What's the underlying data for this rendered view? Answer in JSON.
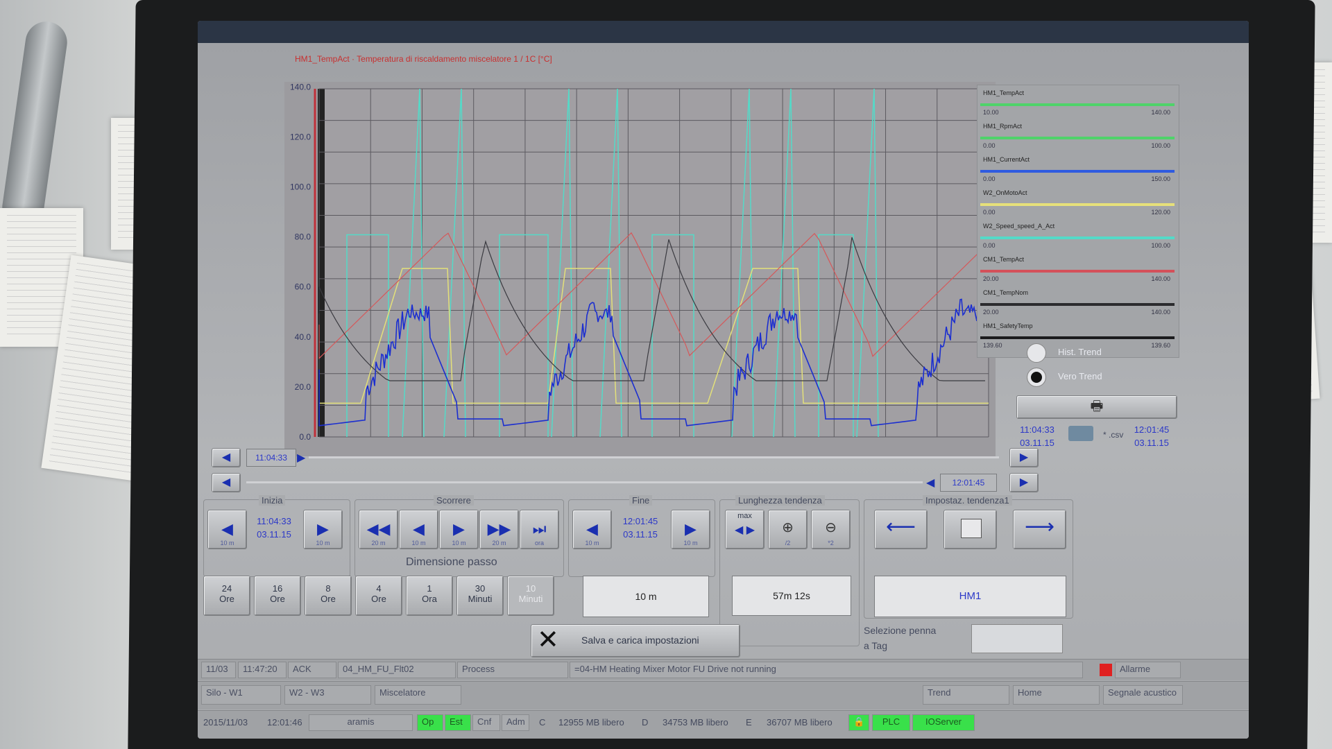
{
  "plot": {
    "title": "HM1_TempAct · Temperatura di riscaldamento miscelatore 1 / 1C [°C]",
    "y_ticks": [
      "0.0",
      "20.0",
      "40.0",
      "60.0",
      "80.0",
      "100.0",
      "120.0",
      "140.0"
    ],
    "colors": {
      "blue": "#1b2ed0",
      "yellow": "#e3e07a",
      "cyan": "#54dac8",
      "red": "#d5585a",
      "dark": "#3a3a40"
    }
  },
  "legend": {
    "items": [
      {
        "tag": "HM1_TempAct",
        "color": "#4fd36a",
        "min": "10.00",
        "max": "140.00"
      },
      {
        "tag": "HM1_RpmAct",
        "color": "#4fd36a",
        "min": "0.00",
        "max": "100.00"
      },
      {
        "tag": "HM1_CurrentAct",
        "color": "#2f5be0",
        "min": "0.00",
        "max": "150.00"
      },
      {
        "tag": "W2_OnMotoAct",
        "color": "#e6e07a",
        "min": "0.00",
        "max": "120.00"
      },
      {
        "tag": "W2_Speed_speed_A_Act",
        "color": "#54dac8",
        "min": "0.00",
        "max": "100.00"
      },
      {
        "tag": "CM1_TempAct",
        "color": "#d4505a",
        "min": "20.00",
        "max": "140.00"
      },
      {
        "tag": "CM1_TempNom",
        "color": "#2b2b2e",
        "min": "20.00",
        "max": "140.00"
      },
      {
        "tag": "HM1_SafetyTemp",
        "color": "#1b1b1d",
        "min": "139.60",
        "max": "139.60"
      }
    ]
  },
  "radios": {
    "hist": "Hist. Trend",
    "live": "Vero Trend"
  },
  "export": {
    "start": "11:04:33",
    "start_date": "03.11.15",
    "end": "12:01:45",
    "end_date": "03.11.15",
    "csv": "* .csv"
  },
  "scroll": {
    "start_time": "11:04:33",
    "end_time": "12:01:45"
  },
  "inizia": {
    "title": "Inizia",
    "time": "11:04:33",
    "date": "03.11.15",
    "back_small": "10 m",
    "fwd_small": "10 m"
  },
  "scorrere": {
    "title": "Scorrere",
    "b1": "20 m",
    "b2": "10 m",
    "b3": "10 m",
    "b4": "20 m",
    "b5": "ora"
  },
  "fine": {
    "title": "Fine",
    "time": "12:01:45",
    "date": "03.11.15",
    "back_small": "10 m",
    "fwd_small": "10 m"
  },
  "lunghezza": {
    "title": "Lunghezza tendenza",
    "max": "max",
    "zoom_in": "/2",
    "zoom_out": "*2",
    "value": "57m 12s"
  },
  "impostaz": {
    "title": "Impostaz. tendenza1",
    "tag": "HM1"
  },
  "passo": {
    "title": "Dimensione passo",
    "buttons": [
      [
        "24",
        "Ore"
      ],
      [
        "16",
        "Ore"
      ],
      [
        "8",
        "Ore"
      ],
      [
        "4",
        "Ore"
      ],
      [
        "1",
        "Ora"
      ],
      [
        "30",
        "Minuti"
      ],
      [
        "10",
        "Minuti"
      ]
    ],
    "value": "10 m"
  },
  "salva": "Salva e carica impostazioni",
  "selezione": {
    "line1": "Selezione penna",
    "line2": "a Tag"
  },
  "alarm": {
    "date": "11/03",
    "time": "11:47:20",
    "ack": "ACK",
    "code": "04_HM_FU_Flt02",
    "type": "Process",
    "message": "=04-HM Heating Mixer Motor FU Drive not running",
    "allarme": "Allarme"
  },
  "nav": {
    "f2": "Silo - W1",
    "f3": "W2 - W3",
    "f4": "Miscelatore",
    "trend": "Trend",
    "home": "Home",
    "segnale": "Segnale acustico"
  },
  "status": {
    "datetime": "2015/11/03",
    "clock": "12:01:46",
    "user": "aramis",
    "op": "Op",
    "est": "Est",
    "cnf": "Cnf",
    "adm": "Adm",
    "c_lbl": "C",
    "c_val": "12955 MB libero",
    "d_lbl": "D",
    "d_val": "34753 MB libero",
    "e_lbl": "E",
    "e_val": "36707 MB libero",
    "plc": "PLC",
    "ioserver": "IOServer"
  }
}
